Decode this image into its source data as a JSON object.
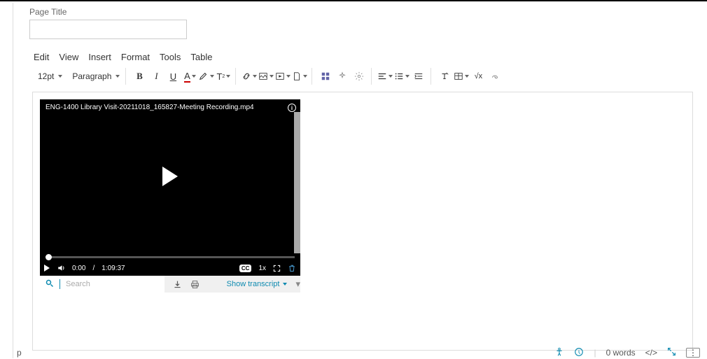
{
  "pageTitleLabel": "Page Title",
  "pageTitleValue": "",
  "menu": {
    "edit": "Edit",
    "view": "View",
    "insert": "Insert",
    "format": "Format",
    "tools": "Tools",
    "table": "Table"
  },
  "toolbar": {
    "fontSize": "12pt",
    "blockType": "Paragraph"
  },
  "video": {
    "title": "ENG-1400 Library Visit-20211018_165827-Meeting Recording.mp4",
    "currentTime": "0:00",
    "duration": "1:09:37",
    "speed": "1x",
    "cc": "CC",
    "searchPlaceholder": "Search",
    "showTranscript": "Show transcript"
  },
  "status": {
    "leftChar": "p",
    "wordCount": "0 words",
    "htmlTag": "</>"
  }
}
